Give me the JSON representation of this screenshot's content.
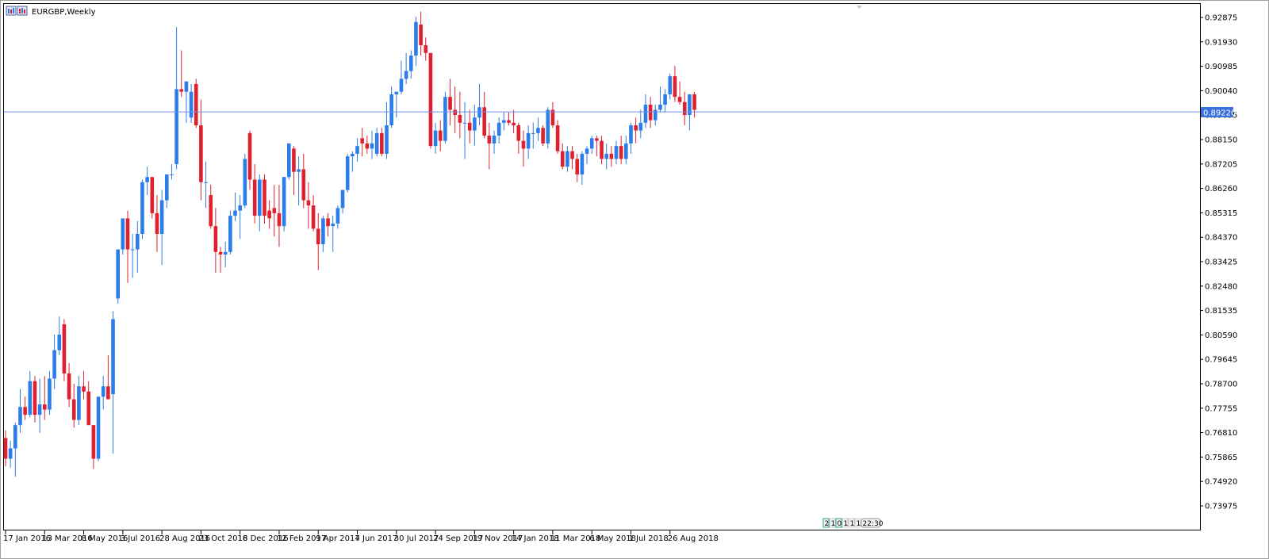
{
  "window": {
    "title": "EURGBP,Weekly"
  },
  "colors": {
    "bull": "#2b7de9",
    "bear": "#e0202e",
    "price_line": "#6f8fe8",
    "badge": "#3a72dd",
    "axis": "#000000"
  },
  "icons": {
    "title_icon": "chart-window-icon",
    "scroll_marker": "triangle-down-icon"
  },
  "timer": {
    "digits": [
      "2",
      "1",
      "0",
      "1",
      "1",
      "1"
    ],
    "time": "22:30"
  },
  "chart_data": {
    "type": "candlestick",
    "title": "EURGBP,Weekly",
    "current_price": "0.89220",
    "y_ticks": [
      "0.92875",
      "0.91930",
      "0.90985",
      "0.90040",
      "0.89095",
      "0.88150",
      "0.87205",
      "0.86260",
      "0.85315",
      "0.84370",
      "0.83425",
      "0.82480",
      "0.81535",
      "0.80590",
      "0.79645",
      "0.78700",
      "0.77755",
      "0.76810",
      "0.75865",
      "0.74920",
      "0.73975"
    ],
    "x_ticks": [
      "17 Jan 2016",
      "13 Mar 2016",
      "8 May 2016",
      "3 Jul 2016",
      "28 Aug 2016",
      "23 Oct 2016",
      "18 Dec 2016",
      "12 Feb 2017",
      "9 Apr 2017",
      "4 Jun 2017",
      "30 Jul 2017",
      "24 Sep 2017",
      "19 Nov 2017",
      "14 Jan 2018",
      "11 Mar 2018",
      "6 May 2018",
      "1 Jul 2018",
      "26 Aug 2018"
    ],
    "grid": false,
    "ohlc": [
      [
        0.766,
        0.769,
        0.755,
        0.758
      ],
      [
        0.758,
        0.765,
        0.7545,
        0.762
      ],
      [
        0.762,
        0.772,
        0.751,
        0.771
      ],
      [
        0.771,
        0.785,
        0.768,
        0.778
      ],
      [
        0.778,
        0.782,
        0.773,
        0.775
      ],
      [
        0.775,
        0.792,
        0.774,
        0.788
      ],
      [
        0.788,
        0.79,
        0.772,
        0.775
      ],
      [
        0.775,
        0.789,
        0.768,
        0.779
      ],
      [
        0.779,
        0.79,
        0.773,
        0.777
      ],
      [
        0.777,
        0.792,
        0.775,
        0.789
      ],
      [
        0.789,
        0.806,
        0.785,
        0.8
      ],
      [
        0.8,
        0.813,
        0.798,
        0.806
      ],
      [
        0.81,
        0.812,
        0.788,
        0.791
      ],
      [
        0.791,
        0.795,
        0.778,
        0.781
      ],
      [
        0.781,
        0.787,
        0.77,
        0.773
      ],
      [
        0.773,
        0.79,
        0.771,
        0.786
      ],
      [
        0.786,
        0.792,
        0.781,
        0.784
      ],
      [
        0.784,
        0.788,
        0.771,
        0.771
      ],
      [
        0.771,
        0.771,
        0.754,
        0.758
      ],
      [
        0.758,
        0.782,
        0.757,
        0.782
      ],
      [
        0.782,
        0.79,
        0.777,
        0.786
      ],
      [
        0.786,
        0.798,
        0.781,
        0.781
      ],
      [
        0.783,
        0.815,
        0.76,
        0.812
      ],
      [
        0.82,
        0.832,
        0.818,
        0.839
      ],
      [
        0.839,
        0.845,
        0.837,
        0.851
      ],
      [
        0.851,
        0.854,
        0.826,
        0.839
      ],
      [
        0.839,
        0.845,
        0.828,
        0.839
      ],
      [
        0.839,
        0.85,
        0.83,
        0.845
      ],
      [
        0.845,
        0.866,
        0.843,
        0.865
      ],
      [
        0.865,
        0.871,
        0.86,
        0.867
      ],
      [
        0.867,
        0.867,
        0.851,
        0.853
      ],
      [
        0.853,
        0.86,
        0.838,
        0.845
      ],
      [
        0.845,
        0.862,
        0.833,
        0.858
      ],
      [
        0.858,
        0.868,
        0.855,
        0.868
      ],
      [
        0.868,
        0.872,
        0.866,
        0.868
      ],
      [
        0.872,
        0.925,
        0.87,
        0.901
      ],
      [
        0.901,
        0.916,
        0.898,
        0.9
      ],
      [
        0.9,
        0.904,
        0.888,
        0.904
      ],
      [
        0.89,
        0.903,
        0.888,
        0.9
      ],
      [
        0.903,
        0.905,
        0.886,
        0.887
      ],
      [
        0.887,
        0.897,
        0.858,
        0.865
      ],
      [
        0.865,
        0.873,
        0.855,
        0.865
      ],
      [
        0.86,
        0.864,
        0.847,
        0.848
      ],
      [
        0.848,
        0.855,
        0.83,
        0.838
      ],
      [
        0.838,
        0.84,
        0.83,
        0.837
      ],
      [
        0.837,
        0.842,
        0.832,
        0.838
      ],
      [
        0.838,
        0.854,
        0.837,
        0.852
      ],
      [
        0.852,
        0.861,
        0.85,
        0.854
      ],
      [
        0.854,
        0.86,
        0.843,
        0.856
      ],
      [
        0.856,
        0.876,
        0.855,
        0.874
      ],
      [
        0.884,
        0.885,
        0.862,
        0.866
      ],
      [
        0.866,
        0.872,
        0.849,
        0.852
      ],
      [
        0.852,
        0.868,
        0.846,
        0.866
      ],
      [
        0.866,
        0.868,
        0.849,
        0.852
      ],
      [
        0.854,
        0.858,
        0.847,
        0.851
      ],
      [
        0.855,
        0.864,
        0.844,
        0.853
      ],
      [
        0.853,
        0.864,
        0.84,
        0.848
      ],
      [
        0.848,
        0.867,
        0.846,
        0.867
      ],
      [
        0.867,
        0.88,
        0.866,
        0.88
      ],
      [
        0.878,
        0.879,
        0.86,
        0.869
      ],
      [
        0.869,
        0.875,
        0.856,
        0.87
      ],
      [
        0.87,
        0.876,
        0.855,
        0.858
      ],
      [
        0.858,
        0.865,
        0.847,
        0.856
      ],
      [
        0.856,
        0.86,
        0.846,
        0.847
      ],
      [
        0.847,
        0.853,
        0.831,
        0.841
      ],
      [
        0.841,
        0.852,
        0.838,
        0.851
      ],
      [
        0.851,
        0.853,
        0.844,
        0.848
      ],
      [
        0.848,
        0.852,
        0.838,
        0.849
      ],
      [
        0.849,
        0.856,
        0.847,
        0.855
      ],
      [
        0.855,
        0.862,
        0.853,
        0.862
      ],
      [
        0.862,
        0.876,
        0.861,
        0.875
      ],
      [
        0.875,
        0.877,
        0.869,
        0.876
      ],
      [
        0.876,
        0.882,
        0.873,
        0.879
      ],
      [
        0.882,
        0.886,
        0.875,
        0.88
      ],
      [
        0.88,
        0.883,
        0.876,
        0.878
      ],
      [
        0.878,
        0.885,
        0.874,
        0.88
      ],
      [
        0.876,
        0.886,
        0.875,
        0.884
      ],
      [
        0.884,
        0.886,
        0.875,
        0.876
      ],
      [
        0.876,
        0.896,
        0.874,
        0.887
      ],
      [
        0.887,
        0.902,
        0.886,
        0.899
      ],
      [
        0.899,
        0.9,
        0.89,
        0.9
      ],
      [
        0.9,
        0.912,
        0.899,
        0.905
      ],
      [
        0.905,
        0.915,
        0.903,
        0.908
      ],
      [
        0.908,
        0.916,
        0.905,
        0.914
      ],
      [
        0.914,
        0.929,
        0.91,
        0.927
      ],
      [
        0.926,
        0.931,
        0.914,
        0.918
      ],
      [
        0.918,
        0.921,
        0.912,
        0.915
      ],
      [
        0.915,
        0.915,
        0.878,
        0.879
      ],
      [
        0.879,
        0.888,
        0.876,
        0.885
      ],
      [
        0.885,
        0.889,
        0.877,
        0.881
      ],
      [
        0.881,
        0.9,
        0.88,
        0.898
      ],
      [
        0.898,
        0.905,
        0.887,
        0.893
      ],
      [
        0.893,
        0.902,
        0.884,
        0.891
      ],
      [
        0.891,
        0.9,
        0.882,
        0.888
      ],
      [
        0.888,
        0.896,
        0.874,
        0.888
      ],
      [
        0.888,
        0.893,
        0.88,
        0.885
      ],
      [
        0.885,
        0.895,
        0.879,
        0.89
      ],
      [
        0.89,
        0.903,
        0.887,
        0.894
      ],
      [
        0.894,
        0.9,
        0.882,
        0.883
      ],
      [
        0.883,
        0.888,
        0.87,
        0.88
      ],
      [
        0.88,
        0.885,
        0.876,
        0.883
      ],
      [
        0.883,
        0.89,
        0.88,
        0.888
      ],
      [
        0.888,
        0.892,
        0.885,
        0.889
      ],
      [
        0.889,
        0.892,
        0.887,
        0.888
      ],
      [
        0.888,
        0.893,
        0.884,
        0.887
      ],
      [
        0.887,
        0.888,
        0.876,
        0.881
      ],
      [
        0.881,
        0.885,
        0.871,
        0.878
      ],
      [
        0.878,
        0.887,
        0.874,
        0.884
      ],
      [
        0.884,
        0.888,
        0.878,
        0.884
      ],
      [
        0.884,
        0.89,
        0.881,
        0.886
      ],
      [
        0.886,
        0.887,
        0.879,
        0.88
      ],
      [
        0.88,
        0.894,
        0.878,
        0.893
      ],
      [
        0.893,
        0.896,
        0.886,
        0.887
      ],
      [
        0.887,
        0.889,
        0.876,
        0.877
      ],
      [
        0.877,
        0.88,
        0.87,
        0.871
      ],
      [
        0.871,
        0.879,
        0.869,
        0.877
      ],
      [
        0.877,
        0.879,
        0.87,
        0.874
      ],
      [
        0.874,
        0.876,
        0.865,
        0.868
      ],
      [
        0.868,
        0.877,
        0.864,
        0.876
      ],
      [
        0.876,
        0.879,
        0.872,
        0.878
      ],
      [
        0.878,
        0.883,
        0.876,
        0.882
      ],
      [
        0.882,
        0.883,
        0.875,
        0.881
      ],
      [
        0.881,
        0.883,
        0.872,
        0.874
      ],
      [
        0.874,
        0.88,
        0.87,
        0.876
      ],
      [
        0.876,
        0.879,
        0.871,
        0.874
      ],
      [
        0.874,
        0.881,
        0.872,
        0.879
      ],
      [
        0.879,
        0.883,
        0.872,
        0.874
      ],
      [
        0.874,
        0.883,
        0.872,
        0.88
      ],
      [
        0.88,
        0.888,
        0.876,
        0.887
      ],
      [
        0.887,
        0.89,
        0.88,
        0.885
      ],
      [
        0.885,
        0.893,
        0.882,
        0.888
      ],
      [
        0.888,
        0.899,
        0.886,
        0.895
      ],
      [
        0.895,
        0.898,
        0.886,
        0.889
      ],
      [
        0.889,
        0.895,
        0.887,
        0.893
      ],
      [
        0.893,
        0.902,
        0.892,
        0.895
      ],
      [
        0.895,
        0.901,
        0.892,
        0.899
      ],
      [
        0.899,
        0.907,
        0.897,
        0.906
      ],
      [
        0.906,
        0.91,
        0.896,
        0.898
      ],
      [
        0.898,
        0.904,
        0.895,
        0.896
      ],
      [
        0.896,
        0.9,
        0.887,
        0.891
      ],
      [
        0.891,
        0.899,
        0.885,
        0.899
      ],
      [
        0.899,
        0.9,
        0.89,
        0.893
      ]
    ]
  }
}
